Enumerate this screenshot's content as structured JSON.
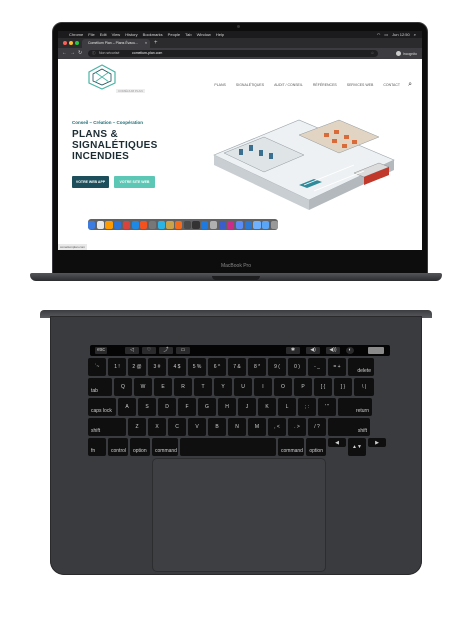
{
  "menubar": {
    "apple": "",
    "items": [
      "Chrome",
      "File",
      "Edit",
      "View",
      "History",
      "Bookmarks",
      "People",
      "Tab",
      "Window",
      "Help"
    ],
    "clock": "Jun 12:50"
  },
  "browser": {
    "tab_title": "Comélium Plan – Plans Évacu...",
    "tab_close": "×",
    "new_tab": "+",
    "nav": {
      "back": "←",
      "forward": "→",
      "reload": "↻"
    },
    "secure_label": "Non sécurisé",
    "url": "comelium-plan.com",
    "profile_label": "Incognito",
    "status_url": "comeliumplan.com"
  },
  "site": {
    "logo_caption": "COMÉLIUM PLAN",
    "nav_items": [
      "PLANS",
      "SIGNALÉTIQUES",
      "AUDIT / CONSEIL",
      "RÉFÉRENCES",
      "SERVICES WEB",
      "CONTACT"
    ],
    "tagline": "Conseil – Création – Coopération",
    "headline_lines": [
      "PLANS &",
      "SIGNALÉTIQUES",
      "INCENDIES"
    ],
    "button_webapp": "VOTRE WEB APP",
    "button_site": "VOTRE SITE WEB"
  },
  "device": {
    "model_label": "MacBook Pro"
  },
  "dock_colors": [
    "#3c7be0",
    "#e8e8e8",
    "#ff9a00",
    "#2e74d6",
    "#d8433d",
    "#1e88e5",
    "#f4511e",
    "#777",
    "#2bb3e6",
    "#caa24a",
    "#f36b1c",
    "#4a4a4a",
    "#333",
    "#1f7ae0",
    "#b0b0b0",
    "#3a5fcd",
    "#cc2b8a",
    "#5a8ef6",
    "#2b79d3",
    "#6fb1ff",
    "#5aa5f6",
    "#999"
  ],
  "touchbar": {
    "left_keys": [
      "esc",
      "◁",
      "♡",
      "⤴",
      "▭"
    ],
    "right_keys": [
      "✱",
      "◀)",
      "◀))",
      "◐"
    ]
  },
  "keyboard": {
    "rows": [
      [
        "`~",
        "1 !",
        "2 @",
        "3 #",
        "4 $",
        "5 %",
        "6 ^",
        "7 &",
        "8 *",
        "9 (",
        "0 )",
        "- _",
        "= +",
        "delete"
      ],
      [
        "tab",
        "Q",
        "W",
        "E",
        "R",
        "T",
        "Y",
        "U",
        "I",
        "O",
        "P",
        "[ {",
        "] }",
        "\\ |"
      ],
      [
        "caps lock",
        "A",
        "S",
        "D",
        "F",
        "G",
        "H",
        "J",
        "K",
        "L",
        "; :",
        "' \"",
        "return"
      ],
      [
        "shift",
        "Z",
        "X",
        "C",
        "V",
        "B",
        "N",
        "M",
        ", <",
        ". >",
        "/ ?",
        "shift"
      ],
      [
        "fn",
        "control",
        "option",
        "command",
        "",
        "command",
        "option",
        "◀",
        "▲▼",
        "▶"
      ]
    ]
  }
}
